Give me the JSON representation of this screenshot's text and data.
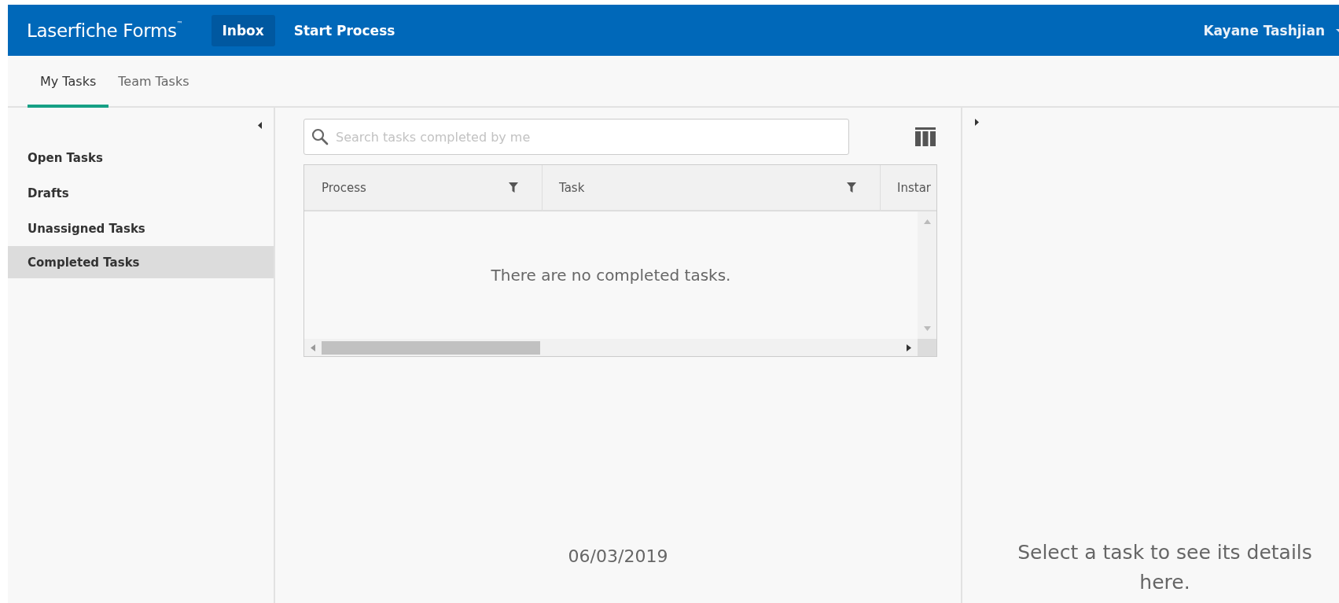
{
  "header": {
    "logo": "Laserfiche Forms",
    "trademark": "™",
    "nav": [
      {
        "label": "Inbox",
        "selected": true
      },
      {
        "label": "Start Process",
        "selected": false
      }
    ],
    "user": "Kayane Tashjian"
  },
  "tabs": [
    {
      "label": "My Tasks",
      "selected": true
    },
    {
      "label": "Team Tasks",
      "selected": false
    }
  ],
  "sidebar": {
    "items": [
      {
        "label": "Open Tasks",
        "selected": false
      },
      {
        "label": "Drafts",
        "selected": false
      },
      {
        "label": "Unassigned Tasks",
        "selected": false
      },
      {
        "label": "Completed Tasks",
        "selected": true
      }
    ]
  },
  "search": {
    "placeholder": "Search tasks completed by me"
  },
  "table": {
    "columns": [
      {
        "label": "Process"
      },
      {
        "label": "Task"
      },
      {
        "label": "Instar"
      }
    ],
    "empty_message": "There are no completed tasks."
  },
  "date": "06/03/2019",
  "details": {
    "message": "Select a task to see its details here."
  }
}
